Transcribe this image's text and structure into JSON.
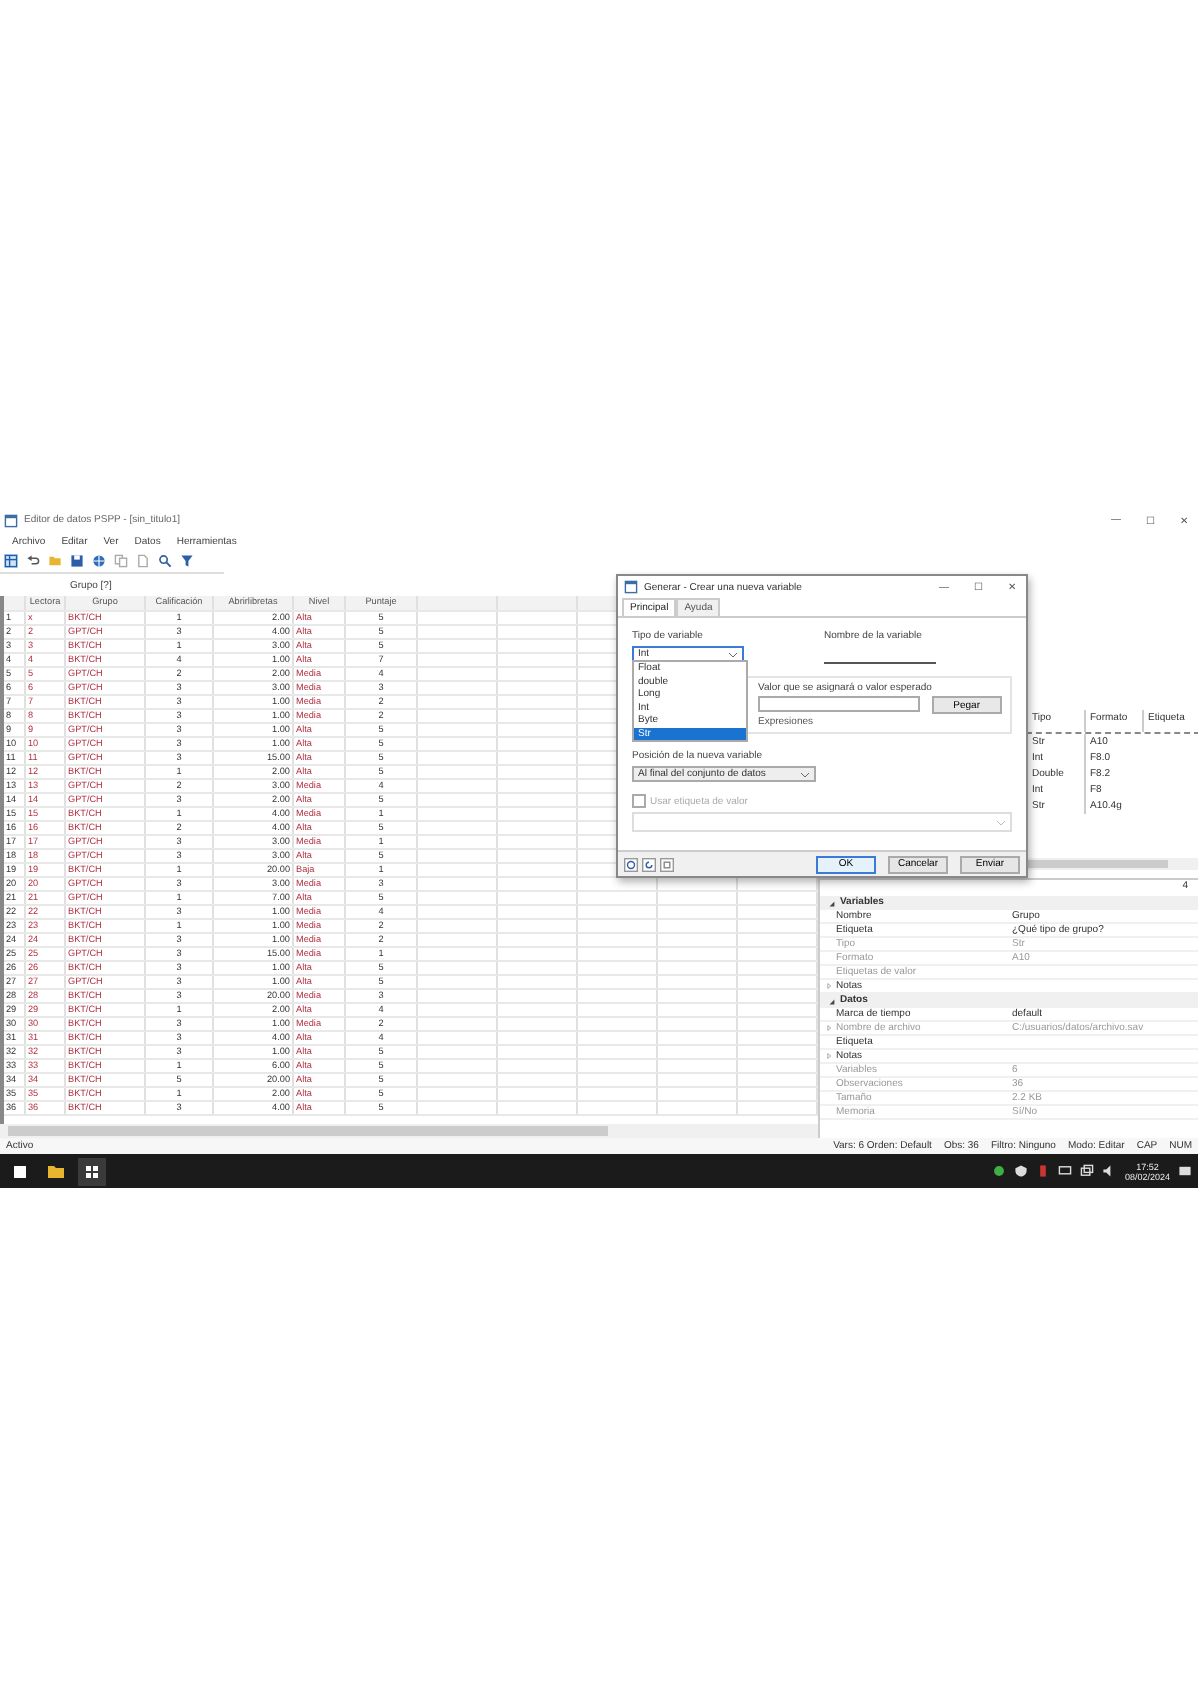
{
  "window": {
    "title": "Editor de datos PSPP - [sin_titulo1]",
    "controls": [
      "—",
      "☐",
      "✕"
    ]
  },
  "menu": [
    "Archivo",
    "Editar",
    "Ver",
    "Datos",
    "Herramientas"
  ],
  "group_label": "Grupo [?]",
  "grid": {
    "columns": [
      "Lectora",
      "Grupo",
      "Calificación",
      "Abrirlibretas",
      "Nivel",
      "Puntaje"
    ],
    "rows": [
      {
        "n": "1",
        "id": "x",
        "code": "BKT/CH",
        "a": "1",
        "b": "2.00",
        "level": "Alta",
        "score": "5"
      },
      {
        "n": "2",
        "id": "2",
        "code": "GPT/CH",
        "a": "3",
        "b": "4.00",
        "level": "Alta",
        "score": "5"
      },
      {
        "n": "3",
        "id": "3",
        "code": "BKT/CH",
        "a": "1",
        "b": "3.00",
        "level": "Alta",
        "score": "5"
      },
      {
        "n": "4",
        "id": "4",
        "code": "BKT/CH",
        "a": "4",
        "b": "1.00",
        "level": "Alta",
        "score": "7"
      },
      {
        "n": "5",
        "id": "5",
        "code": "GPT/CH",
        "a": "2",
        "b": "2.00",
        "level": "Media",
        "score": "4"
      },
      {
        "n": "6",
        "id": "6",
        "code": "GPT/CH",
        "a": "3",
        "b": "3.00",
        "level": "Media",
        "score": "3"
      },
      {
        "n": "7",
        "id": "7",
        "code": "BKT/CH",
        "a": "3",
        "b": "1.00",
        "level": "Media",
        "score": "2"
      },
      {
        "n": "8",
        "id": "8",
        "code": "BKT/CH",
        "a": "3",
        "b": "1.00",
        "level": "Media",
        "score": "2"
      },
      {
        "n": "9",
        "id": "9",
        "code": "GPT/CH",
        "a": "3",
        "b": "1.00",
        "level": "Alta",
        "score": "5"
      },
      {
        "n": "10",
        "id": "10",
        "code": "GPT/CH",
        "a": "3",
        "b": "1.00",
        "level": "Alta",
        "score": "5"
      },
      {
        "n": "11",
        "id": "11",
        "code": "GPT/CH",
        "a": "3",
        "b": "15.00",
        "level": "Alta",
        "score": "5"
      },
      {
        "n": "12",
        "id": "12",
        "code": "BKT/CH",
        "a": "1",
        "b": "2.00",
        "level": "Alta",
        "score": "5"
      },
      {
        "n": "13",
        "id": "13",
        "code": "GPT/CH",
        "a": "2",
        "b": "3.00",
        "level": "Media",
        "score": "4"
      },
      {
        "n": "14",
        "id": "14",
        "code": "GPT/CH",
        "a": "3",
        "b": "2.00",
        "level": "Alta",
        "score": "5"
      },
      {
        "n": "15",
        "id": "15",
        "code": "BKT/CH",
        "a": "1",
        "b": "4.00",
        "level": "Media",
        "score": "1"
      },
      {
        "n": "16",
        "id": "16",
        "code": "BKT/CH",
        "a": "2",
        "b": "4.00",
        "level": "Alta",
        "score": "5"
      },
      {
        "n": "17",
        "id": "17",
        "code": "GPT/CH",
        "a": "3",
        "b": "3.00",
        "level": "Media",
        "score": "1"
      },
      {
        "n": "18",
        "id": "18",
        "code": "GPT/CH",
        "a": "3",
        "b": "3.00",
        "level": "Alta",
        "score": "5"
      },
      {
        "n": "19",
        "id": "19",
        "code": "BKT/CH",
        "a": "1",
        "b": "20.00",
        "level": "Baja",
        "score": "1"
      },
      {
        "n": "20",
        "id": "20",
        "code": "GPT/CH",
        "a": "3",
        "b": "3.00",
        "level": "Media",
        "score": "3"
      },
      {
        "n": "21",
        "id": "21",
        "code": "GPT/CH",
        "a": "1",
        "b": "7.00",
        "level": "Alta",
        "score": "5"
      },
      {
        "n": "22",
        "id": "22",
        "code": "BKT/CH",
        "a": "3",
        "b": "1.00",
        "level": "Media",
        "score": "4"
      },
      {
        "n": "23",
        "id": "23",
        "code": "BKT/CH",
        "a": "1",
        "b": "1.00",
        "level": "Media",
        "score": "2"
      },
      {
        "n": "24",
        "id": "24",
        "code": "BKT/CH",
        "a": "3",
        "b": "1.00",
        "level": "Media",
        "score": "2"
      },
      {
        "n": "25",
        "id": "25",
        "code": "GPT/CH",
        "a": "3",
        "b": "15.00",
        "level": "Media",
        "score": "1"
      },
      {
        "n": "26",
        "id": "26",
        "code": "BKT/CH",
        "a": "3",
        "b": "1.00",
        "level": "Alta",
        "score": "5"
      },
      {
        "n": "27",
        "id": "27",
        "code": "GPT/CH",
        "a": "3",
        "b": "1.00",
        "level": "Alta",
        "score": "5"
      },
      {
        "n": "28",
        "id": "28",
        "code": "BKT/CH",
        "a": "3",
        "b": "20.00",
        "level": "Media",
        "score": "3"
      },
      {
        "n": "29",
        "id": "29",
        "code": "BKT/CH",
        "a": "1",
        "b": "2.00",
        "level": "Alta",
        "score": "4"
      },
      {
        "n": "30",
        "id": "30",
        "code": "BKT/CH",
        "a": "3",
        "b": "1.00",
        "level": "Media",
        "score": "2"
      },
      {
        "n": "31",
        "id": "31",
        "code": "BKT/CH",
        "a": "3",
        "b": "4.00",
        "level": "Alta",
        "score": "4"
      },
      {
        "n": "32",
        "id": "32",
        "code": "BKT/CH",
        "a": "3",
        "b": "1.00",
        "level": "Alta",
        "score": "5"
      },
      {
        "n": "33",
        "id": "33",
        "code": "BKT/CH",
        "a": "1",
        "b": "6.00",
        "level": "Alta",
        "score": "5"
      },
      {
        "n": "34",
        "id": "34",
        "code": "BKT/CH",
        "a": "5",
        "b": "20.00",
        "level": "Alta",
        "score": "5"
      },
      {
        "n": "35",
        "id": "35",
        "code": "BKT/CH",
        "a": "1",
        "b": "2.00",
        "level": "Alta",
        "score": "5"
      },
      {
        "n": "36",
        "id": "36",
        "code": "BKT/CH",
        "a": "3",
        "b": "4.00",
        "level": "Alta",
        "score": "5"
      }
    ]
  },
  "variables_table": {
    "columns": [
      "Tipo",
      "Formato",
      "Etiqueta"
    ],
    "rows": [
      [
        "Str",
        "A10"
      ],
      [
        "Int",
        "F8.0"
      ],
      [
        "Double",
        "F8.2"
      ],
      [
        "Int",
        "F8"
      ],
      [
        "Str",
        "A10.4g"
      ]
    ]
  },
  "properties": {
    "corner": "4",
    "sections": [
      {
        "title": "Variables",
        "expanded": true,
        "items": [
          {
            "kind": "field",
            "label": "Nombre",
            "value": "Grupo",
            "readonly": false
          },
          {
            "kind": "field",
            "label": "Etiqueta",
            "value": "¿Qué tipo de grupo?",
            "readonly": false
          },
          {
            "kind": "field",
            "label": "Tipo",
            "value": "Str",
            "readonly": true
          },
          {
            "kind": "field",
            "label": "Formato",
            "value": "A10",
            "readonly": true
          },
          {
            "kind": "field",
            "label": "Etiquetas de valor",
            "value": "",
            "readonly": true
          },
          {
            "kind": "group",
            "label": "Notas",
            "value": "",
            "readonly": false
          }
        ]
      },
      {
        "title": "Datos",
        "expanded": true,
        "items": [
          {
            "kind": "field",
            "label": "Marca de tiempo",
            "value": "default",
            "readonly": false
          },
          {
            "kind": "group",
            "label": "Nombre de archivo",
            "value": "C:/usuarios/datos/archivo.sav",
            "readonly": true
          },
          {
            "kind": "field",
            "label": "Etiqueta",
            "value": "",
            "readonly": false
          },
          {
            "kind": "group",
            "label": "Notas",
            "value": "",
            "readonly": false
          },
          {
            "kind": "field",
            "label": "Variables",
            "value": "6",
            "readonly": true
          },
          {
            "kind": "field",
            "label": "Observaciones",
            "value": "36",
            "readonly": true
          },
          {
            "kind": "field",
            "label": "Tamaño",
            "value": "2.2 KB",
            "readonly": true
          },
          {
            "kind": "field",
            "label": "Memoria",
            "value": "Sí/No",
            "readonly": true
          }
        ]
      }
    ]
  },
  "status_bar": {
    "left": "Activo",
    "items": [
      "Vars: 6 Orden: Default",
      "Obs: 36",
      "Filtro: Ninguno",
      "Modo: Editar",
      "CAP",
      "NUM"
    ]
  },
  "dialog": {
    "title": "Generar - Crear una nueva variable",
    "controls": [
      "—",
      "☐",
      "✕"
    ],
    "tabs": [
      {
        "label": "Principal",
        "selected": true
      },
      {
        "label": "Ayuda",
        "selected": false
      }
    ],
    "type_label": "Tipo de variable",
    "type_value": "Int",
    "type_options": [
      {
        "label": "Float",
        "selected": false
      },
      {
        "label": "double",
        "selected": false
      },
      {
        "label": "Long",
        "selected": false
      },
      {
        "label": "Int",
        "selected": false
      },
      {
        "label": "Byte",
        "selected": false
      },
      {
        "label": "Str",
        "selected": true
      }
    ],
    "name_label": "Nombre de la variable",
    "expr_label": "Valor que se asignará o valor esperado",
    "expr_button": "Pegar",
    "expr_note": "Expresiones",
    "position_label": "Posición de la nueva variable",
    "position_value": "Al final del conjunto de datos",
    "label_checkbox": {
      "label": "Usar etiqueta de valor",
      "checked": false,
      "disabled": true
    },
    "buttons": [
      "OK",
      "Cancelar",
      "Enviar"
    ]
  },
  "taskbar": {
    "time": "17:52",
    "date": "08/02/2024"
  }
}
